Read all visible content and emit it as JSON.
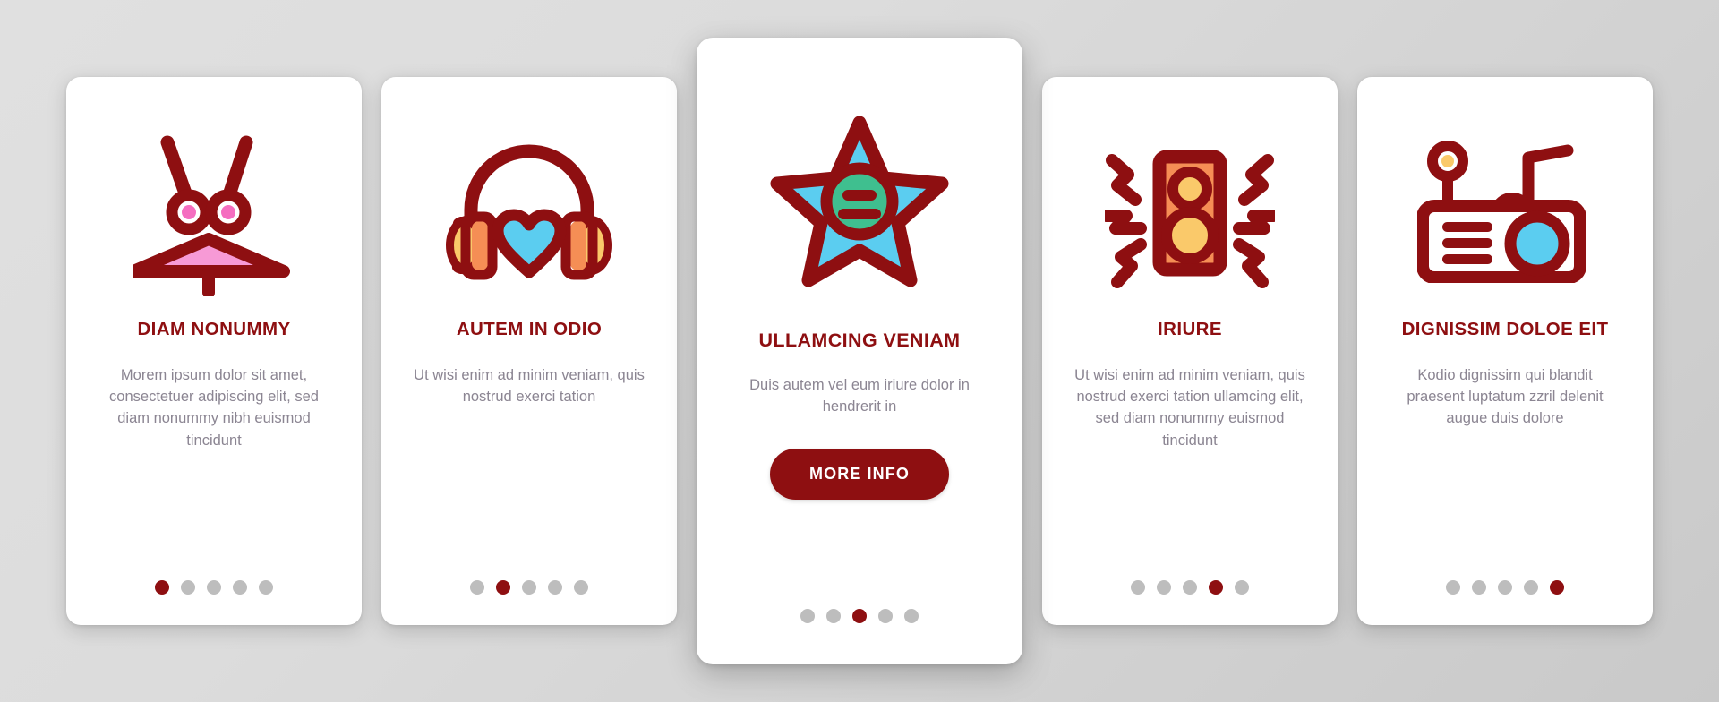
{
  "theme": {
    "background_start": "#e0e0e0",
    "background_end": "#c9c9c9",
    "card_background": "#ffffff",
    "accent_dark_red": "#8e0f11",
    "body_text": "#8b8592",
    "dot_inactive": "#bdbdbd",
    "icon_cyan": "#5bcdf0",
    "icon_orange": "#f58e55",
    "icon_yellow": "#fac96a",
    "icon_pink": "#f56dc0",
    "icon_light_pink": "#f79ad6",
    "icon_green": "#3fbf8f"
  },
  "cards": [
    {
      "icon_name": "drum-cymbal-icon",
      "title": "DIAM NONUMMY",
      "body": "Morem ipsum dolor sit amet, consectetuer adipiscing elit, sed diam nonummy nibh euismod tincidunt",
      "dots": {
        "count": 5,
        "active_index": 0
      },
      "featured": false
    },
    {
      "icon_name": "headphones-heart-icon",
      "title": "AUTEM IN ODIO",
      "body": "Ut wisi enim ad minim veniam, quis nostrud exerci tation",
      "dots": {
        "count": 5,
        "active_index": 1
      },
      "featured": false
    },
    {
      "icon_name": "star-equalizer-icon",
      "title": "ULLAMCING VENIAM",
      "body": "Duis autem vel eum iriure dolor in hendrerit in",
      "cta_label": "MORE INFO",
      "dots": {
        "count": 5,
        "active_index": 2
      },
      "featured": true
    },
    {
      "icon_name": "loudspeaker-icon",
      "title": "IRIURE",
      "body": "Ut wisi enim ad minim veniam, quis nostrud exerci tation ullamcing elit, sed diam nonummy euismod tincidunt",
      "dots": {
        "count": 5,
        "active_index": 3
      },
      "featured": false
    },
    {
      "icon_name": "radio-music-icon",
      "title": "DIGNISSIM DOLOE EIT",
      "body": "Kodio dignissim qui blandit praesent luptatum zzril delenit augue duis dolore",
      "dots": {
        "count": 5,
        "active_index": 4
      },
      "featured": false
    }
  ]
}
